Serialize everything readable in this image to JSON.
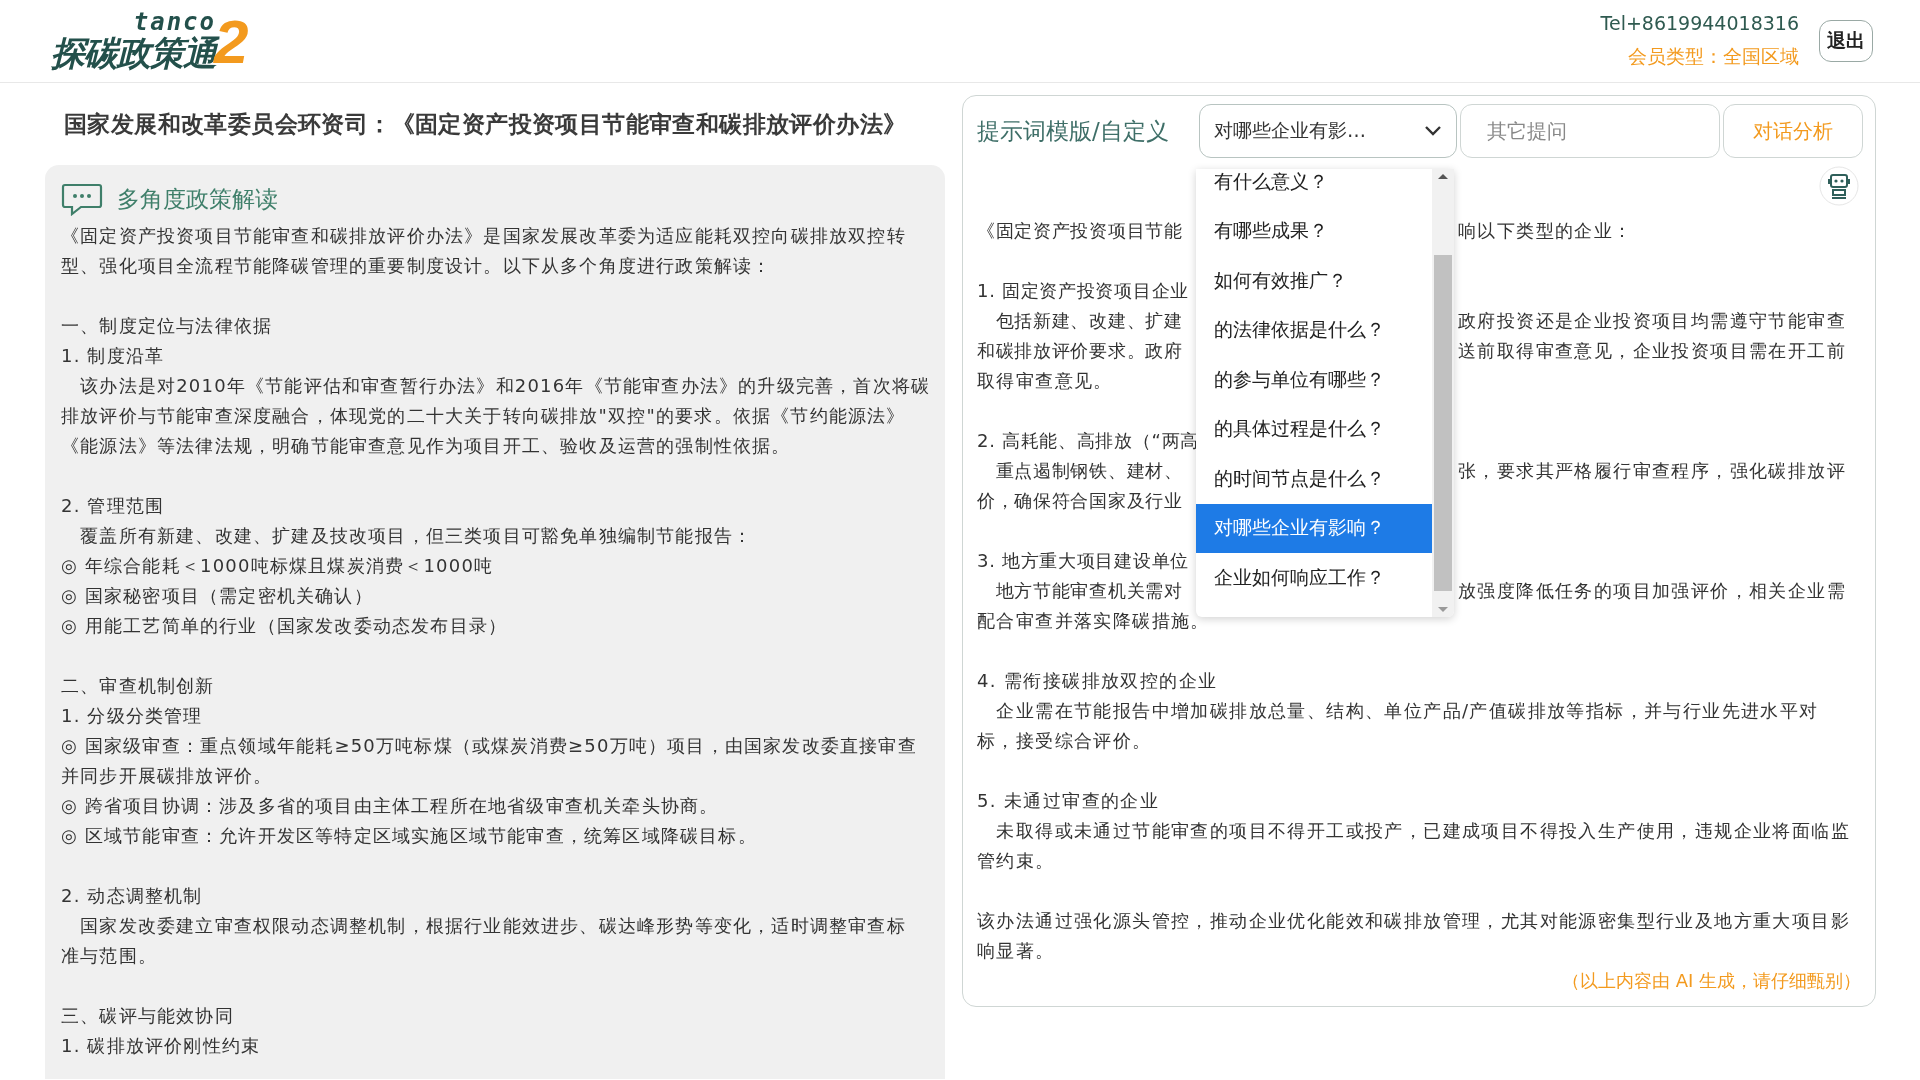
{
  "header": {
    "logo": {
      "latin": "tanco",
      "name": "探碳政策通",
      "mark": "2"
    },
    "phone": "Tel+8619944018316",
    "membership": "会员类型：全国区域",
    "logout": "退出"
  },
  "article": {
    "title": "国家发展和改革委员会环资司：《固定资产投资项目节能审查和碳排放评价办法》",
    "section_heading": "多角度政策解读",
    "blocks": [
      [
        "《固定资产投资项目节能审查和碳排放评价办法》是国家发展改革委为适应能耗双控向碳排放双控转",
        "型、强化项目全流程节能降碳管理的重要制度设计。以下从多个角度进行政策解读："
      ],
      [
        "一、制度定位与法律依据",
        "1. 制度沿革",
        "　该办法是对2010年《节能评估和审查暂行办法》和2016年《节能审查办法》的升级完善，首次将碳",
        "排放评价与节能审查深度融合，体现党的二十大关于转向碳排放\"双控\"的要求。依据《节约能源法》",
        "《能源法》等法律法规，明确节能审查意见作为项目开工、验收及运营的强制性依据。"
      ],
      [
        "2. 管理范围",
        "　覆盖所有新建、改建、扩建及技改项目，但三类项目可豁免单独编制节能报告：",
        "◎ 年综合能耗＜1000吨标煤且煤炭消费＜1000吨",
        "◎ 国家秘密项目（需定密机关确认）",
        "◎ 用能工艺简单的行业（国家发改委动态发布目录）"
      ],
      [
        "二、审查机制创新",
        "1. 分级分类管理",
        "◎ 国家级审查：重点领域年能耗≥50万吨标煤（或煤炭消费≥50万吨）项目，由国家发改委直接审查",
        "并同步开展碳排放评价。",
        "◎ 跨省项目协调：涉及多省的项目由主体工程所在地省级审查机关牵头协商。",
        "◎ 区域节能审查：允许开发区等特定区域实施区域节能审查，统筹区域降碳目标。"
      ],
      [
        "2. 动态调整机制",
        "　国家发改委建立审查权限动态调整机制，根据行业能效进步、碳达峰形势等变化，适时调整审查标",
        "准与范围。"
      ],
      [
        "三、碳评与能效协同",
        "1. 碳排放评价刚性约束"
      ]
    ]
  },
  "assistant": {
    "prompt_label": "提示词模版/自定义",
    "prompt_select": {
      "value": "对哪些企业有影…",
      "expanded": true,
      "options": [
        {
          "label": "有什么意义？",
          "selected": false
        },
        {
          "label": "有哪些成果？",
          "selected": false
        },
        {
          "label": "如何有效推广？",
          "selected": false
        },
        {
          "label": "的法律依据是什么？",
          "selected": false
        },
        {
          "label": "的参与单位有哪些？",
          "selected": false
        },
        {
          "label": "的具体过程是什么？",
          "selected": false
        },
        {
          "label": "的时间节点是什么？",
          "selected": false
        },
        {
          "label": "对哪些企业有影响？",
          "selected": true
        },
        {
          "label": "企业如何响应工作？",
          "selected": false
        }
      ]
    },
    "question_field": {
      "placeholder": "其它提问"
    },
    "analyze_button": "对话分析",
    "answer": {
      "blocks": [
        [
          {
            "kind": "split",
            "left": "《固定资产投资项目节能",
            "right": "响以下类型的企业："
          }
        ],
        [
          {
            "kind": "split",
            "left": "1. 固定资产投资项目企业"
          },
          {
            "kind": "split",
            "left": "　包括新建、改建、扩建",
            "right": "政府投资还是企业投资项目均需遵守节能审查"
          },
          {
            "kind": "split",
            "left": "和碳排放评价要求。政府",
            "right": "送前取得审查意见，企业投资项目需在开工前"
          },
          {
            "kind": "full",
            "text": "取得审查意见。"
          }
        ],
        [
          {
            "kind": "split",
            "left": "2. 高耗能、高排放（“两高"
          },
          {
            "kind": "split",
            "left": "　重点遏制钢铁、建材、",
            "right": "张，要求其严格履行审查程序，强化碳排放评"
          },
          {
            "kind": "split",
            "left": "价，确保符合国家及行业"
          }
        ],
        [
          {
            "kind": "split",
            "left": "3. 地方重大项目建设单位"
          },
          {
            "kind": "split",
            "left": "　地方节能审查机关需对",
            "right": "放强度降低任务的项目加强评价，相关企业需"
          },
          {
            "kind": "full",
            "text": "配合审查并落实降碳措施。"
          }
        ],
        [
          {
            "kind": "full",
            "text": "4. 需衔接碳排放双控的企业"
          },
          {
            "kind": "full",
            "text": "　企业需在节能报告中增加碳排放总量、结构、单位产品/产值碳排放等指标，并与行业先进水平对"
          },
          {
            "kind": "full",
            "text": "标，接受综合评价。"
          }
        ],
        [
          {
            "kind": "full",
            "text": "5. 未通过审查的企业"
          },
          {
            "kind": "full",
            "text": "　未取得或未通过节能审查的项目不得开工或投产，已建成项目不得投入生产使用，违规企业将面临监"
          },
          {
            "kind": "full",
            "text": "管约束。"
          }
        ],
        [
          {
            "kind": "full",
            "text": "该办法通过强化源头管控，推动企业优化能效和碳排放管理，尤其对能源密集型行业及地方重大项目影"
          },
          {
            "kind": "full",
            "text": "响显著。"
          }
        ]
      ]
    },
    "disclaimer": "（以上内容由 AI 生成，请仔细甄别）"
  }
}
